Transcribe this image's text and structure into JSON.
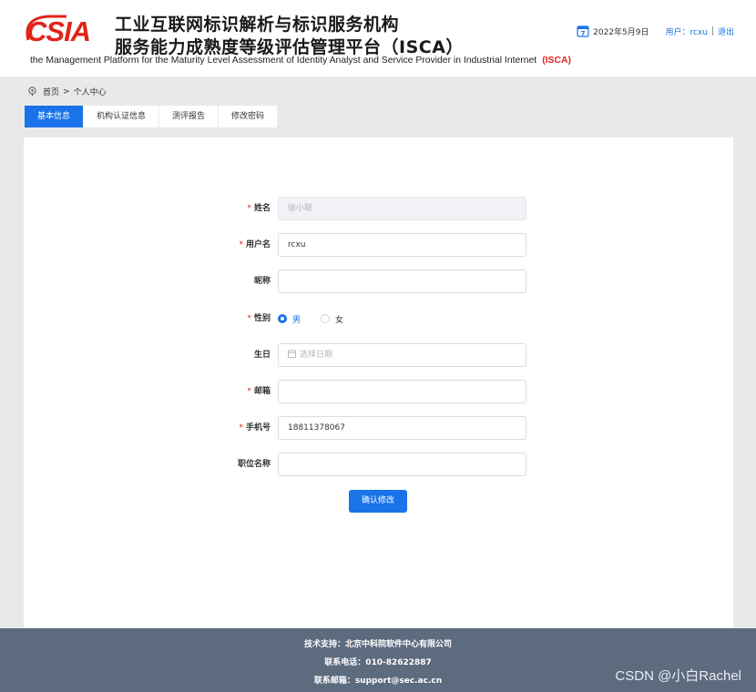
{
  "header": {
    "logo_text": "CSIA",
    "title_line1": "工业互联网标识解析与标识服务机构",
    "title_line2": "服务能力成熟度等级评估管理平台（ISCA）",
    "subtitle": "the Management Platform for the Maturity Level Assessment of Identity Analyst and Service Provider in Industrial Internet",
    "subtitle_abbr": "(ISCA)",
    "date": "2022年5月9日",
    "user_label": "用户：rcxu",
    "logout_label": "退出",
    "calendar_day": "7"
  },
  "breadcrumb": {
    "home": "首页",
    "arrow": ">",
    "current": "个人中心"
  },
  "tabs": [
    {
      "label": "基本信息",
      "active": true
    },
    {
      "label": "机构认证信息",
      "active": false
    },
    {
      "label": "测评报告",
      "active": false
    },
    {
      "label": "修改密码",
      "active": false
    }
  ],
  "form": {
    "name": {
      "label": "姓名",
      "required": true,
      "value": "徐小聪",
      "disabled": true
    },
    "username": {
      "label": "用户名",
      "required": true,
      "value": "rcxu"
    },
    "nickname": {
      "label": "昵称",
      "required": false,
      "value": ""
    },
    "gender": {
      "label": "性别",
      "required": true,
      "options": [
        "男",
        "女"
      ],
      "selected": "男"
    },
    "birthday": {
      "label": "生日",
      "required": false,
      "value": "",
      "placeholder": "选择日期"
    },
    "email": {
      "label": "邮箱",
      "required": true,
      "value": ""
    },
    "phone": {
      "label": "手机号",
      "required": true,
      "value": "18811378067"
    },
    "job_title": {
      "label": "职位名称",
      "required": false,
      "value": ""
    },
    "required_mark": "*",
    "submit_label": "确认修改"
  },
  "footer": {
    "support": "技术支持：北京中科院软件中心有限公司",
    "phone": "联系电话：010-82622887",
    "email": "联系邮箱：support@sec.ac.cn"
  },
  "watermark": "CSDN @小白Rachel",
  "colors": {
    "primary": "#1a73e8",
    "logo_red": "#e2231a",
    "footer_bg": "#5d6b7f"
  }
}
